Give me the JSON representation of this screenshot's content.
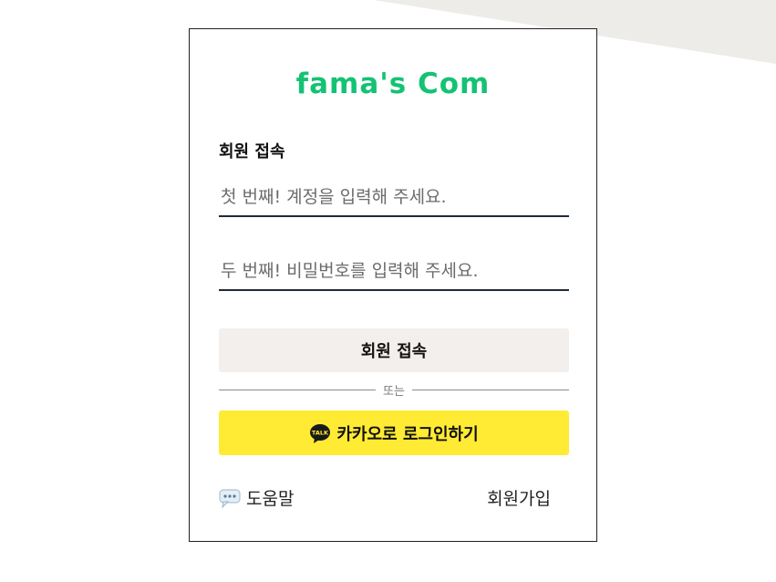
{
  "brand": {
    "title": "fama's Com",
    "color": "#14c274"
  },
  "login": {
    "section_title": "회원 접속",
    "id_placeholder": "첫 번째! 계정을 입력해 주세요.",
    "id_value": "",
    "pw_placeholder": "두 번째! 비밀번호를 입력해 주세요.",
    "pw_value": "",
    "submit_label": "회원 접속",
    "divider_text": "또는",
    "kakao_label": "카카오로 로그인하기",
    "kakao_icon_text": "TALK",
    "kakao_color": "#ffeb34"
  },
  "footer": {
    "help_label": "도움말",
    "help_icon": "speech-bubble-icon",
    "signup_label": "회원가입"
  }
}
